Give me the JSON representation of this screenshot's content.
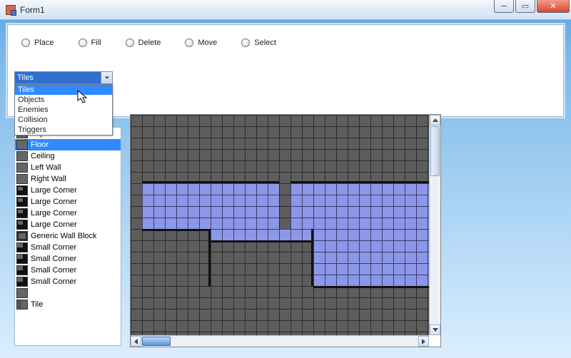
{
  "window": {
    "title": "Form1"
  },
  "tools": {
    "radios": [
      "Place",
      "Fill",
      "Delete",
      "Move",
      "Select"
    ]
  },
  "combo": {
    "selected": "Tiles",
    "options": [
      "Tiles",
      "Objects",
      "Enemies",
      "Collision",
      "Triggers"
    ]
  },
  "tile_list": {
    "selected_index": 1,
    "items": [
      {
        "name": "Sky",
        "swatch": "sky"
      },
      {
        "name": "Floor",
        "swatch": "floor"
      },
      {
        "name": "Ceiling",
        "swatch": "ceiling"
      },
      {
        "name": "Left Wall",
        "swatch": "lwall"
      },
      {
        "name": "Right Wall",
        "swatch": "rwall"
      },
      {
        "name": "Large Corner",
        "swatch": "corner"
      },
      {
        "name": "Large Corner",
        "swatch": "corner"
      },
      {
        "name": "Large Corner",
        "swatch": "corner"
      },
      {
        "name": "Large Corner",
        "swatch": "corner"
      },
      {
        "name": "Generic Wall Block",
        "swatch": "block"
      },
      {
        "name": "Small Corner",
        "swatch": "scorner"
      },
      {
        "name": "Small Corner",
        "swatch": "scorner"
      },
      {
        "name": "Small Corner",
        "swatch": "scorner"
      },
      {
        "name": "Small Corner",
        "swatch": "scorner"
      },
      {
        "name": "",
        "swatch": "tri"
      },
      {
        "name": "Tile",
        "swatch": "tile"
      }
    ]
  },
  "colors": {
    "tile_blue": "#8d97e9",
    "grid_dark": "#2b2b2b",
    "canvas_bg": "#5d5d5d"
  }
}
